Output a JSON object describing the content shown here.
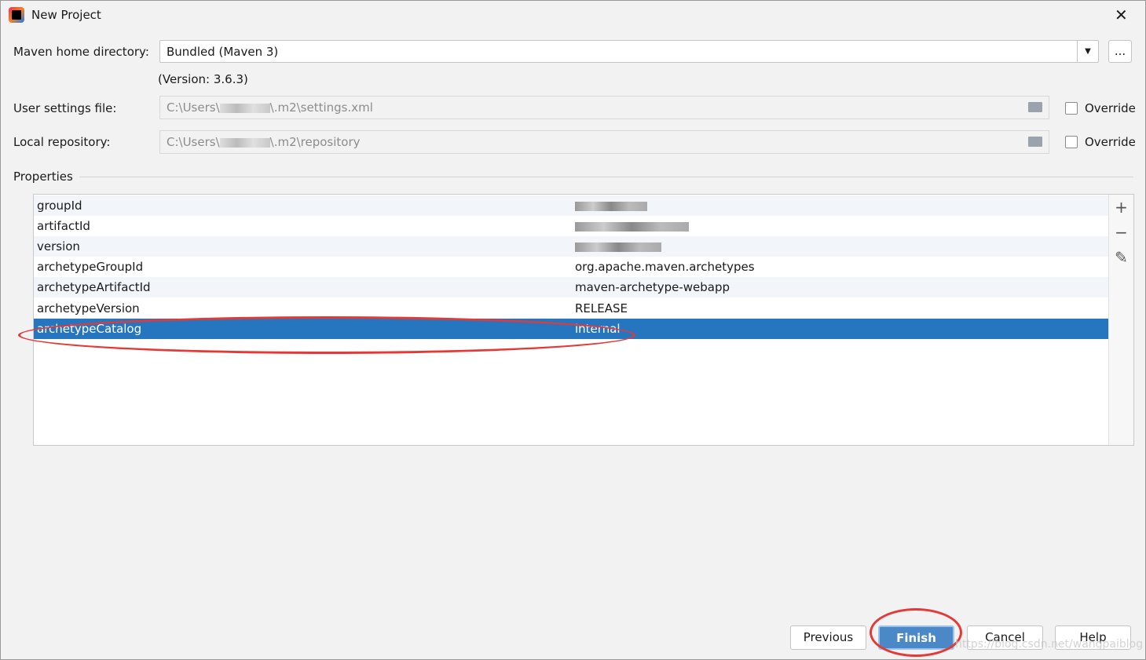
{
  "window": {
    "title": "New Project",
    "close_icon": "close-icon"
  },
  "maven_home": {
    "label": "Maven home directory:",
    "value": "Bundled (Maven 3)",
    "version": "(Version: 3.6.3)",
    "browse_label": "..."
  },
  "user_settings": {
    "label": "User settings file:",
    "prefix": "C:\\Users\\",
    "suffix": "\\.m2\\settings.xml",
    "override_label": "Override",
    "override_checked": false
  },
  "local_repo": {
    "label": "Local repository:",
    "prefix": "C:\\Users\\",
    "suffix": "\\.m2\\repository",
    "override_label": "Override",
    "override_checked": false
  },
  "properties": {
    "label": "Properties",
    "rows": [
      {
        "key": "groupId",
        "value": ""
      },
      {
        "key": "artifactId",
        "value": ""
      },
      {
        "key": "version",
        "value": ""
      },
      {
        "key": "archetypeGroupId",
        "value": "org.apache.maven.archetypes"
      },
      {
        "key": "archetypeArtifactId",
        "value": "maven-archetype-webapp"
      },
      {
        "key": "archetypeVersion",
        "value": "RELEASE"
      },
      {
        "key": "archetypeCatalog",
        "value": "internal"
      }
    ],
    "selected_index": 6,
    "add": "+",
    "remove": "−",
    "edit": "✎"
  },
  "buttons": {
    "previous": "Previous",
    "finish": "Finish",
    "cancel": "Cancel",
    "help": "Help"
  },
  "watermark": "https://blog.csdn.net/wangpaiblog",
  "colors": {
    "selection": "#2675bf",
    "primary_button": "#4a88c7",
    "annotation": "#e53935"
  }
}
